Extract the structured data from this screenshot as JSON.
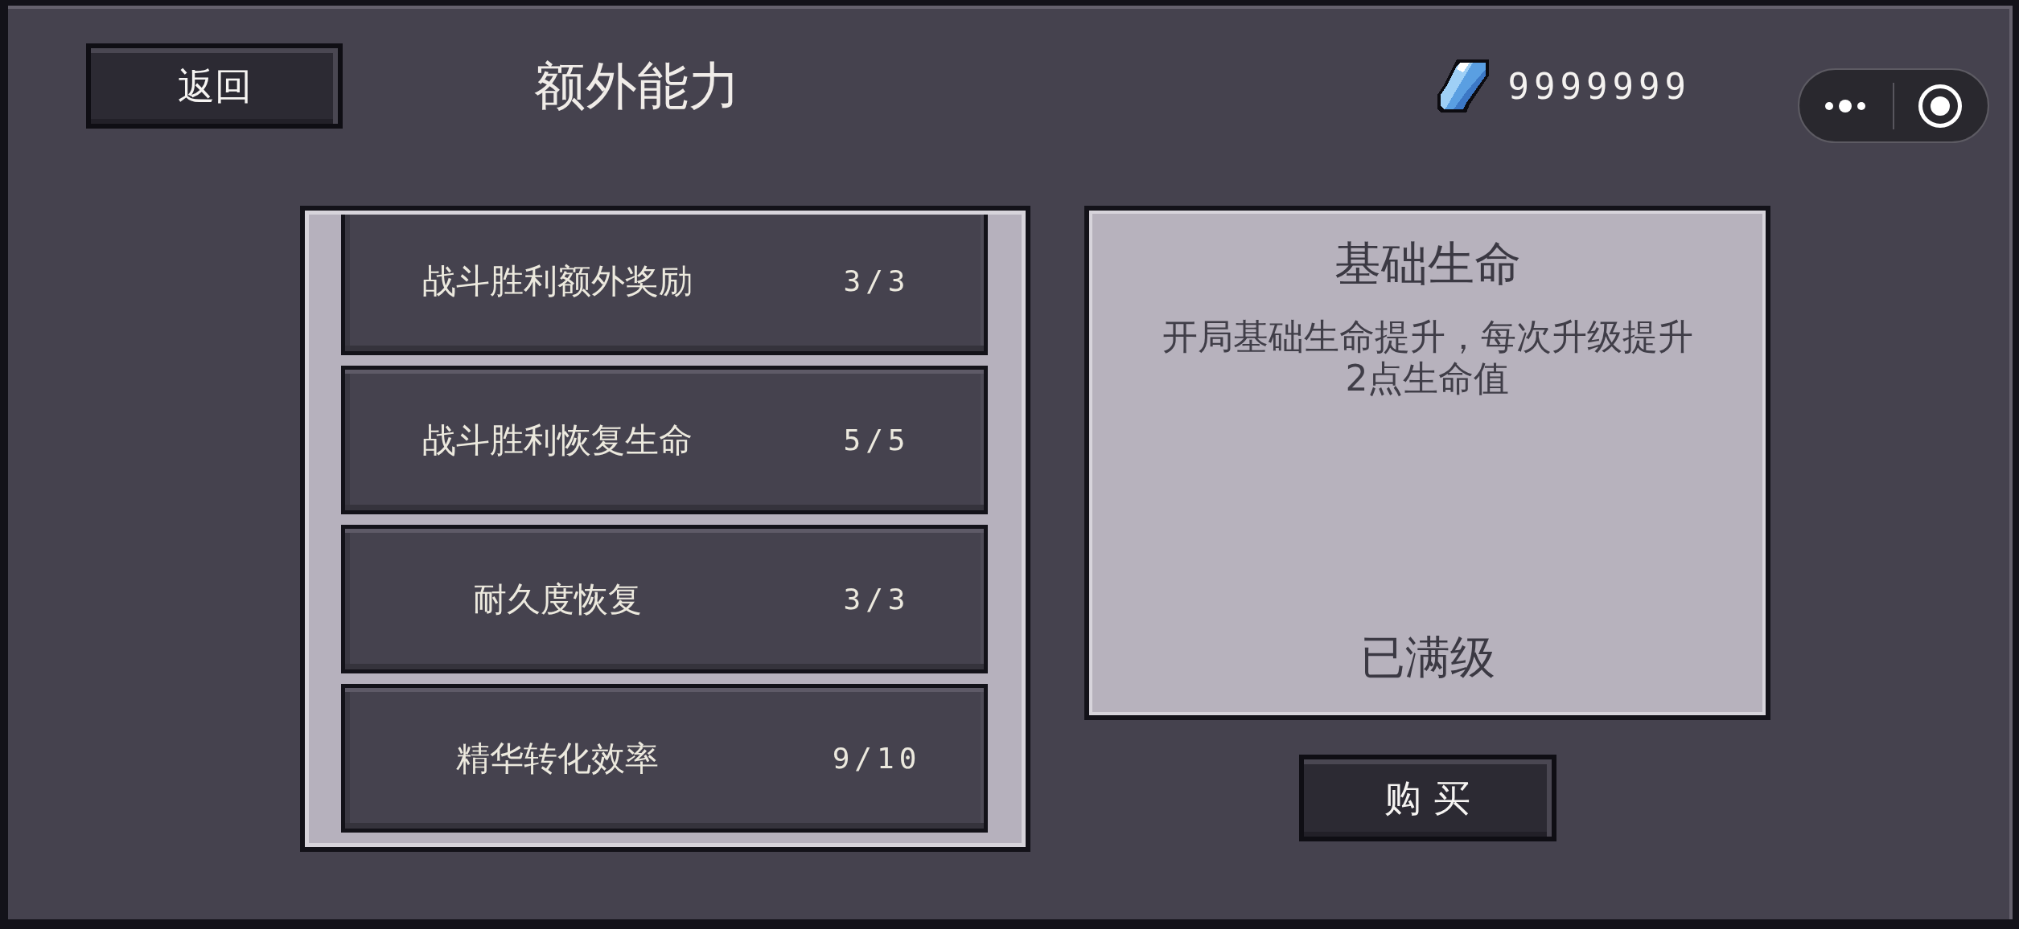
{
  "header": {
    "back_button": "返回",
    "title": "额外能力",
    "currency_amount": "9999999"
  },
  "abilities": [
    {
      "name": "战斗胜利额外奖励",
      "count": "3/3"
    },
    {
      "name": "战斗胜利恢复生命",
      "count": "5/5"
    },
    {
      "name": "耐久度恢复",
      "count": "3/3"
    },
    {
      "name": "精华转化效率",
      "count": "9/10"
    }
  ],
  "detail": {
    "title": "基础生命",
    "description": "开局基础生命提升，每次升级提升2点生命值",
    "status": "已满级",
    "buy_button": "购 买"
  }
}
